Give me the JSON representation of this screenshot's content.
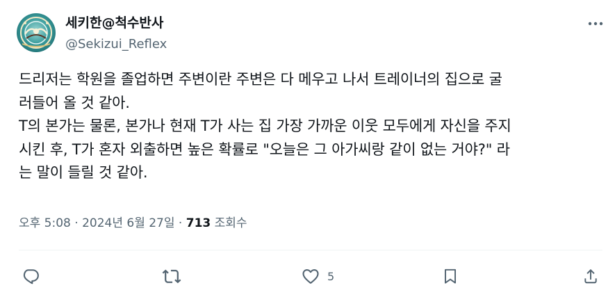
{
  "author": {
    "display_name": "세키한@척수반사",
    "handle": "@Sekizui_Reflex"
  },
  "tweet": {
    "lines": [
      "드리저는 학원을 졸업하면 주변이란 주변은 다 메우고 나서 트레이너의 집으로 굴",
      "러들어 올 것 같아.",
      "T의 본가는 물론, 본가나 현재 T가 사는 집 가장 가까운 이웃 모두에게 자신을 주지",
      "시킨 후, T가 혼자 외출하면 높은 확률로 \"오늘은 그 아가씨랑 같이 없는 거야?\" 라",
      "는 말이 들릴 것 같아."
    ]
  },
  "meta": {
    "time": "오후 5:08",
    "separator1": " · ",
    "date": "2024년 6월 27일",
    "separator2": " · ",
    "views": "713",
    "views_label": " 조회수"
  },
  "actions": {
    "reply": {
      "icon": "reply-icon",
      "count": ""
    },
    "retweet": {
      "icon": "retweet-icon",
      "count": ""
    },
    "like": {
      "icon": "heart-icon",
      "count": "5"
    },
    "bookmark": {
      "icon": "bookmark-icon",
      "count": ""
    },
    "share": {
      "icon": "share-icon",
      "count": ""
    }
  },
  "colors": {
    "text": "#0f1419",
    "secondary": "#536471",
    "divider": "#eff3f4",
    "avatar_bg": "#2a8a8c"
  }
}
